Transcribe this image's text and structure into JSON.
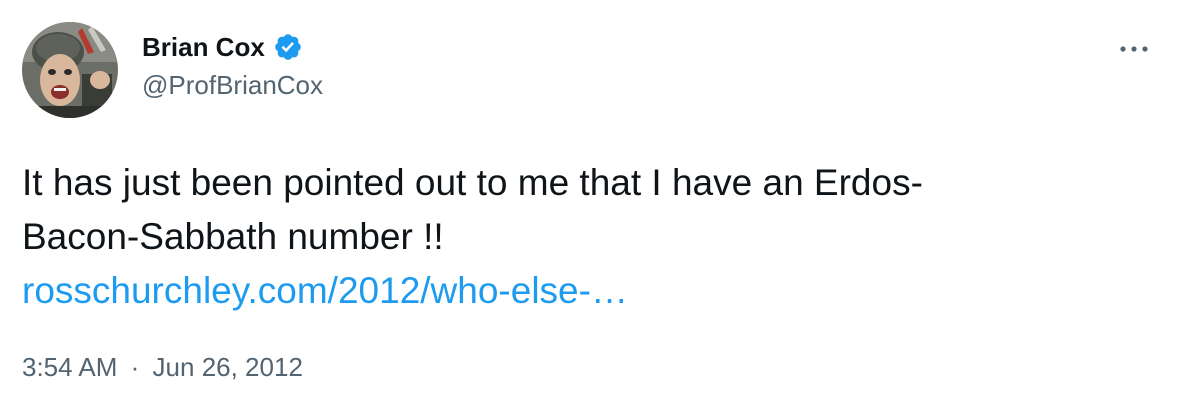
{
  "user": {
    "display_name": "Brian Cox",
    "handle": "@ProfBrianCox",
    "verified": true
  },
  "tweet": {
    "text_line1": "It has just been pointed out to me that I have an Erdos-",
    "text_line2": "Bacon-Sabbath number !!",
    "link_text": "rosschurchley.com/2012/who-else-…",
    "time": "3:54 AM",
    "separator": "·",
    "date": "Jun 26, 2012"
  },
  "icons": {
    "verified": "verified-badge-icon",
    "more": "more-options-icon"
  },
  "colors": {
    "link": "#1d9bf0",
    "secondary_text": "#536471",
    "primary_text": "#0f1419",
    "verified_badge": "#1d9bf0"
  }
}
